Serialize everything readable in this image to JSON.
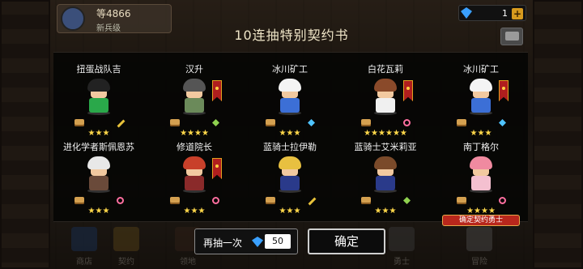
{
  "hud": {
    "player_name": "等4866",
    "player_sub": "新兵级",
    "gem_count": "1",
    "gem_plus": "+"
  },
  "title": "10连抽特别契约书",
  "cards": [
    {
      "name": "扭蛋战队吉",
      "stars": "★★★",
      "element": "sword",
      "hair": "#222",
      "body": "#2aa84a",
      "banner": false
    },
    {
      "name": "汉升",
      "stars": "★★★★",
      "element": "leaf",
      "hair": "#555",
      "body": "#6b8a5a",
      "banner": true
    },
    {
      "name": "冰川矿工",
      "stars": "★★★",
      "element": "ice",
      "hair": "#f4f4f4",
      "body": "#3c6fd6",
      "banner": false
    },
    {
      "name": "白花瓦莉",
      "stars": "★★★★★★",
      "element": "bolt",
      "hair": "#8a4a2a",
      "body": "#f0f0f0",
      "banner": true
    },
    {
      "name": "冰川矿工",
      "stars": "★★★",
      "element": "ice",
      "hair": "#f4f4f4",
      "body": "#3c6fd6",
      "banner": true
    },
    {
      "name": "进化学者斯佩恩苏",
      "stars": "★★★",
      "element": "bolt",
      "hair": "#e8e8e8",
      "body": "#6a4a3a",
      "banner": false
    },
    {
      "name": "修道院长",
      "stars": "★★★",
      "element": "bolt",
      "hair": "#c8402a",
      "body": "#8a2a2a",
      "banner": true
    },
    {
      "name": "蓝骑士拉伊勒",
      "stars": "★★★",
      "element": "sword",
      "hair": "#e8c040",
      "body": "#2a3a8a",
      "banner": false
    },
    {
      "name": "蓝骑士艾米莉亚",
      "stars": "★★★",
      "element": "leaf",
      "hair": "#7a4a2a",
      "body": "#2a3a8a",
      "banner": false
    },
    {
      "name": "南丁格尔",
      "stars": "★★★★",
      "element": "bolt",
      "hair": "#f08aa0",
      "body": "#f4c0d0",
      "banner": false,
      "tag": "确定契约勇士"
    }
  ],
  "buttons": {
    "redraw_label": "再抽一次",
    "redraw_price": "50",
    "confirm_label": "确定"
  },
  "nav": [
    {
      "label": "商店",
      "color": "#2a5aa0"
    },
    {
      "label": "契约",
      "color": "#a07a2a"
    },
    {
      "label": "领地",
      "color": "#5a3a2a"
    },
    {
      "label": "勇士",
      "color": "#6a6a6a"
    },
    {
      "label": "冒险",
      "color": "#8a8a8a"
    }
  ]
}
